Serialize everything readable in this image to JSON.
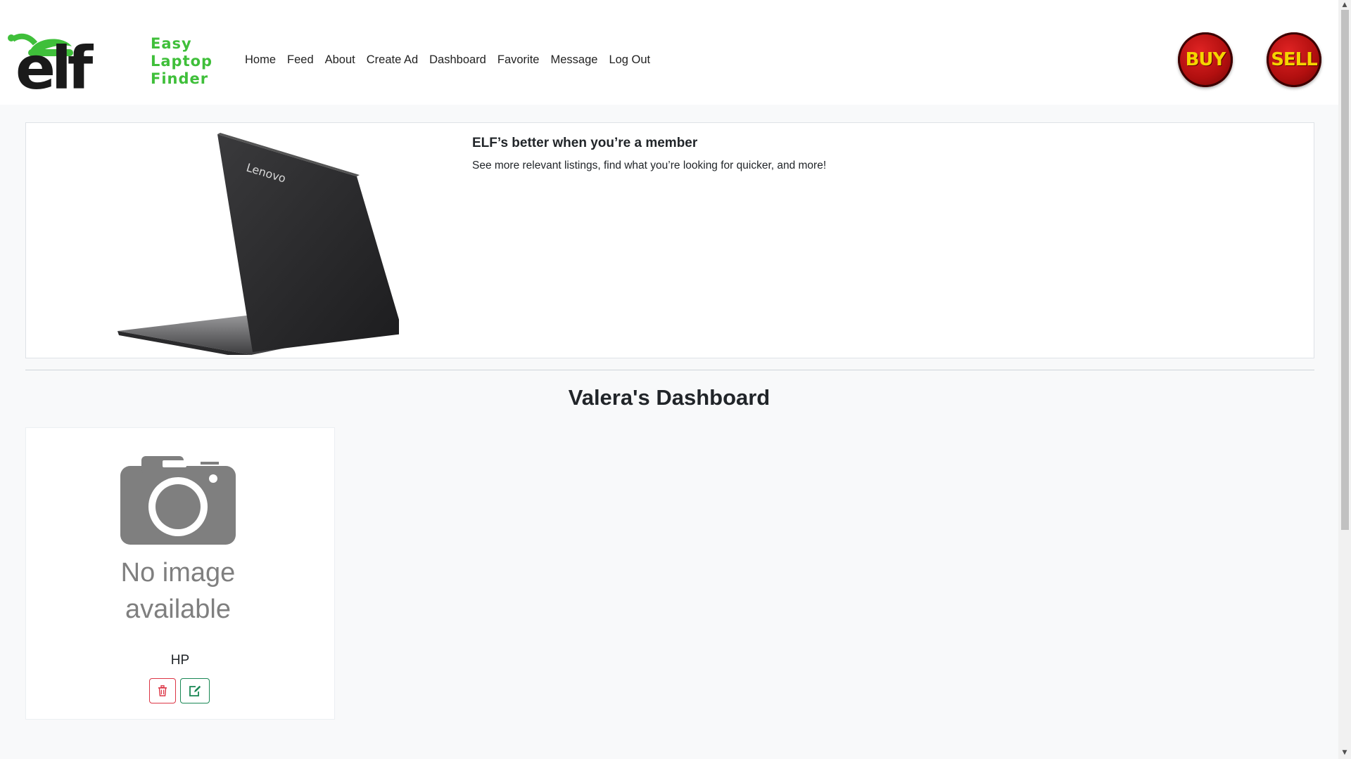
{
  "brand": {
    "logo_text": "elf",
    "tagline_lines": [
      "Easy",
      "Laptop",
      "Finder"
    ],
    "green": "#3fbf3a"
  },
  "nav": {
    "items": [
      "Home",
      "Feed",
      "About",
      "Create Ad",
      "Dashboard",
      "Favorite",
      "Message",
      "Log Out"
    ]
  },
  "actions": {
    "buy_label": "BUY",
    "sell_label": "SELL"
  },
  "hero": {
    "laptop_brand": "Lenovo",
    "title": "ELF’s better when you’re a member",
    "text": "See more relevant listings, find what you’re looking for quicker, and more!"
  },
  "dashboard": {
    "title": "Valera's Dashboard"
  },
  "listings": [
    {
      "image_text_lines": [
        "No image",
        "available"
      ],
      "title": "HP",
      "delete_icon": "trash-icon",
      "edit_icon": "edit-icon"
    }
  ],
  "colors": {
    "danger": "#dc3545",
    "success": "#198754",
    "button_red": "#c01515",
    "button_text": "#f5d400"
  }
}
